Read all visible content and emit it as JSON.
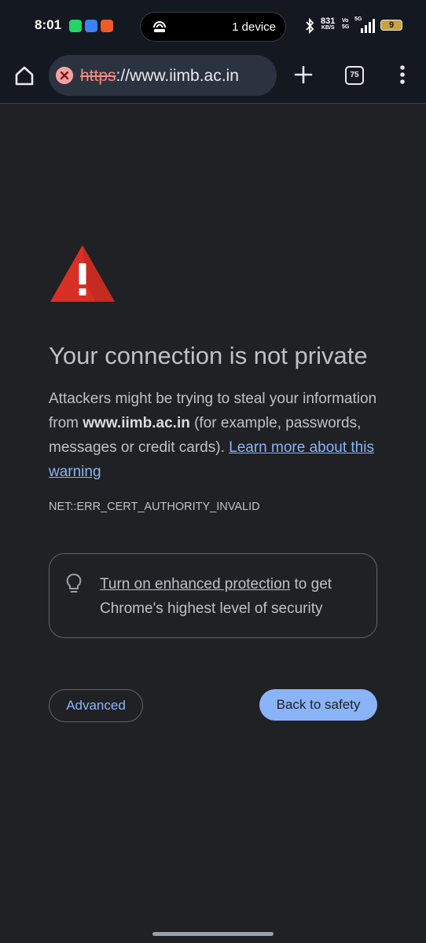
{
  "status_bar": {
    "time": "8:01",
    "island_text": "1 device",
    "net_speed": "831",
    "net_unit": "KB/S",
    "volte": "Vo\n5G",
    "signal_label": "5G",
    "battery": "9"
  },
  "browser": {
    "url_scheme": "https",
    "url_rest": "://www.iimb.ac.in",
    "tab_count": "75"
  },
  "page": {
    "heading": "Your connection is not private",
    "body_part1": "Attackers might be trying to steal your information from ",
    "body_domain": "www.iimb.ac.in",
    "body_part2": " (for example, passwords, messages or credit cards). ",
    "learn_more_link": "Learn more about this warning",
    "error_code": "NET::ERR_CERT_AUTHORITY_INVALID",
    "enhanced_link": "Turn on enhanced protection",
    "enhanced_rest": " to get Chrome's highest level of security",
    "advanced_label": "Advanced",
    "back_to_safety_label": "Back to safety"
  },
  "colors": {
    "accent": "#8ab4f8",
    "warning_red": "#d93025",
    "background": "#202124"
  }
}
